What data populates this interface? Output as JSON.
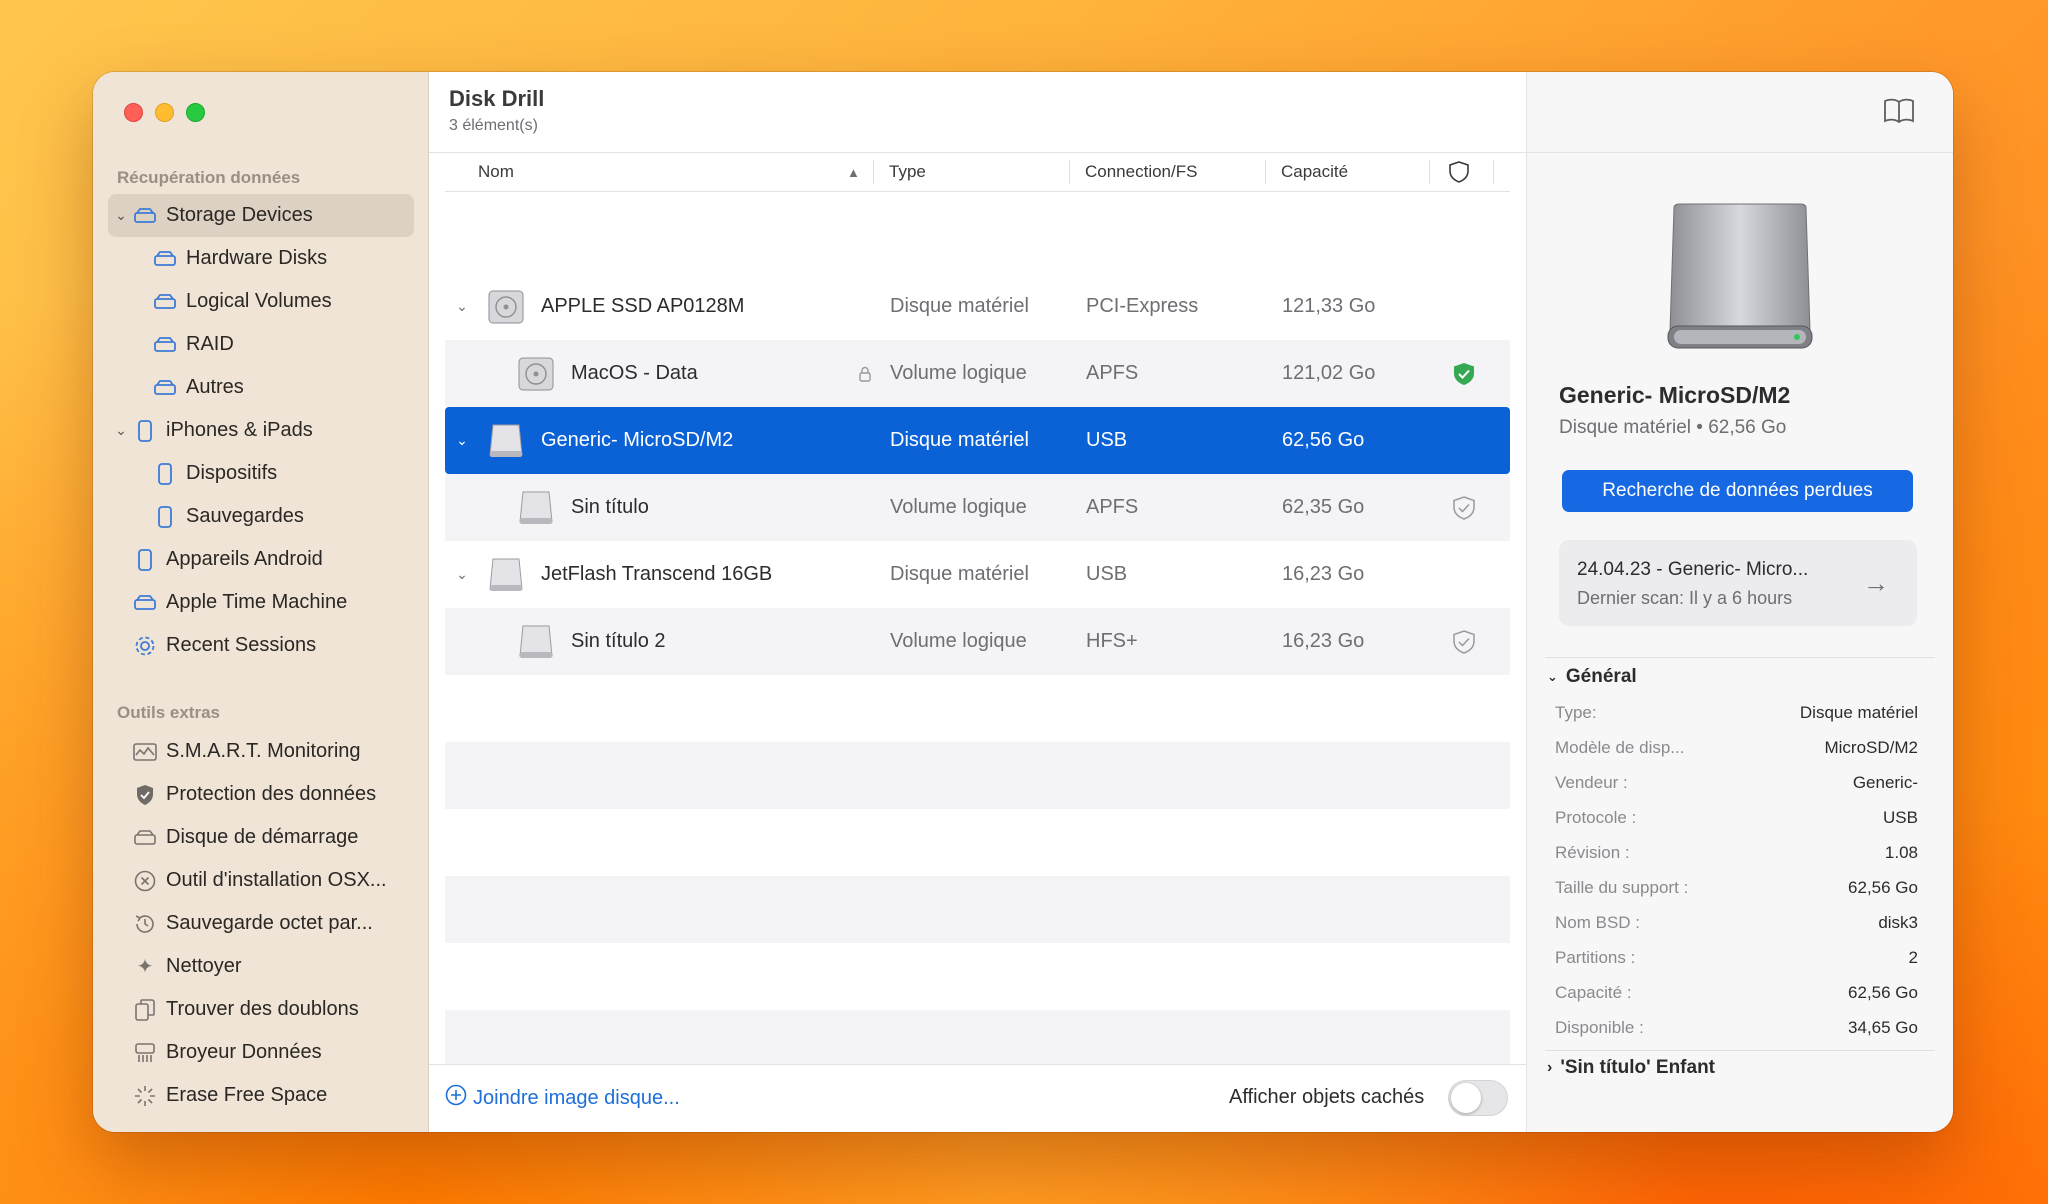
{
  "app": {
    "title": "Disk Drill",
    "item_count": "3 élément(s)"
  },
  "sidebar": {
    "section_recovery": "Récupération données",
    "items": [
      {
        "label": "Storage Devices",
        "icon": "drive-icon"
      },
      {
        "label": "Hardware Disks",
        "icon": "drive-icon"
      },
      {
        "label": "Logical Volumes",
        "icon": "drive-icon"
      },
      {
        "label": "RAID",
        "icon": "drive-icon"
      },
      {
        "label": "Autres",
        "icon": "drive-icon"
      },
      {
        "label": "iPhones & iPads",
        "icon": "phone-icon"
      },
      {
        "label": "Dispositifs",
        "icon": "phone-icon"
      },
      {
        "label": "Sauvegardes",
        "icon": "phone-icon"
      },
      {
        "label": "Appareils Android",
        "icon": "phone-icon"
      },
      {
        "label": "Apple Time Machine",
        "icon": "time-machine-icon"
      },
      {
        "label": "Recent Sessions",
        "icon": "gear-icon"
      }
    ],
    "section_tools": "Outils extras",
    "tools": [
      {
        "label": "S.M.A.R.T. Monitoring",
        "icon": "monitor-icon"
      },
      {
        "label": "Protection des données",
        "icon": "shield-icon"
      },
      {
        "label": "Disque de démarrage",
        "icon": "drive-icon"
      },
      {
        "label": "Outil d'installation OSX...",
        "icon": "close-circle-icon"
      },
      {
        "label": "Sauvegarde octet par...",
        "icon": "history-icon"
      },
      {
        "label": "Nettoyer",
        "icon": "sparkle-icon"
      },
      {
        "label": "Trouver des doublons",
        "icon": "duplicate-icon"
      },
      {
        "label": "Broyeur Données",
        "icon": "shredder-icon"
      },
      {
        "label": "Erase Free Space",
        "icon": "burst-icon"
      }
    ]
  },
  "table": {
    "columns": {
      "name": "Nom",
      "type": "Type",
      "conn": "Connection/FS",
      "cap": "Capacité"
    },
    "rows": [
      {
        "name": "APPLE SSD AP0128M",
        "type": "Disque matériel",
        "conn": "PCI-Express",
        "cap": "121,33 Go"
      },
      {
        "name": "MacOS - Data",
        "type": "Volume logique",
        "conn": "APFS",
        "cap": "121,02 Go"
      },
      {
        "name": "Generic- MicroSD/M2",
        "type": "Disque matériel",
        "conn": "USB",
        "cap": "62,56 Go"
      },
      {
        "name": "Sin título",
        "type": "Volume logique",
        "conn": "APFS",
        "cap": "62,35 Go"
      },
      {
        "name": "JetFlash Transcend 16GB",
        "type": "Disque matériel",
        "conn": "USB",
        "cap": "16,23 Go"
      },
      {
        "name": "Sin título 2",
        "type": "Volume logique",
        "conn": "HFS+",
        "cap": "16,23 Go"
      }
    ]
  },
  "footer": {
    "attach": "Joindre image disque...",
    "show_hidden": "Afficher objets cachés"
  },
  "panel": {
    "device_name": "Generic- MicroSD/M2",
    "device_sub": "Disque matériel • 62,56 Go",
    "search_button": "Recherche de données perdues",
    "session_title": "24.04.23 - Generic- Micro...",
    "session_sub": "Dernier scan: Il y a 6 hours",
    "general": "Général",
    "props": [
      {
        "k": "Type:",
        "v": "Disque matériel"
      },
      {
        "k": "Modèle de disp...",
        "v": "MicroSD/M2"
      },
      {
        "k": "Vendeur :",
        "v": "Generic-"
      },
      {
        "k": "Protocole :",
        "v": "USB"
      },
      {
        "k": "Révision :",
        "v": "1.08"
      },
      {
        "k": "Taille du support :",
        "v": "62,56 Go"
      },
      {
        "k": "Nom BSD :",
        "v": "disk3"
      },
      {
        "k": "Partitions :",
        "v": "2"
      },
      {
        "k": "Capacité :",
        "v": "62,56 Go"
      },
      {
        "k": "Disponible :",
        "v": "34,65 Go"
      }
    ],
    "child": "'Sin título' Enfant"
  },
  "colors": {
    "accent": "#0b62d6",
    "button": "#1669e2",
    "link": "#1e6fd9",
    "protected": "#34a853"
  }
}
